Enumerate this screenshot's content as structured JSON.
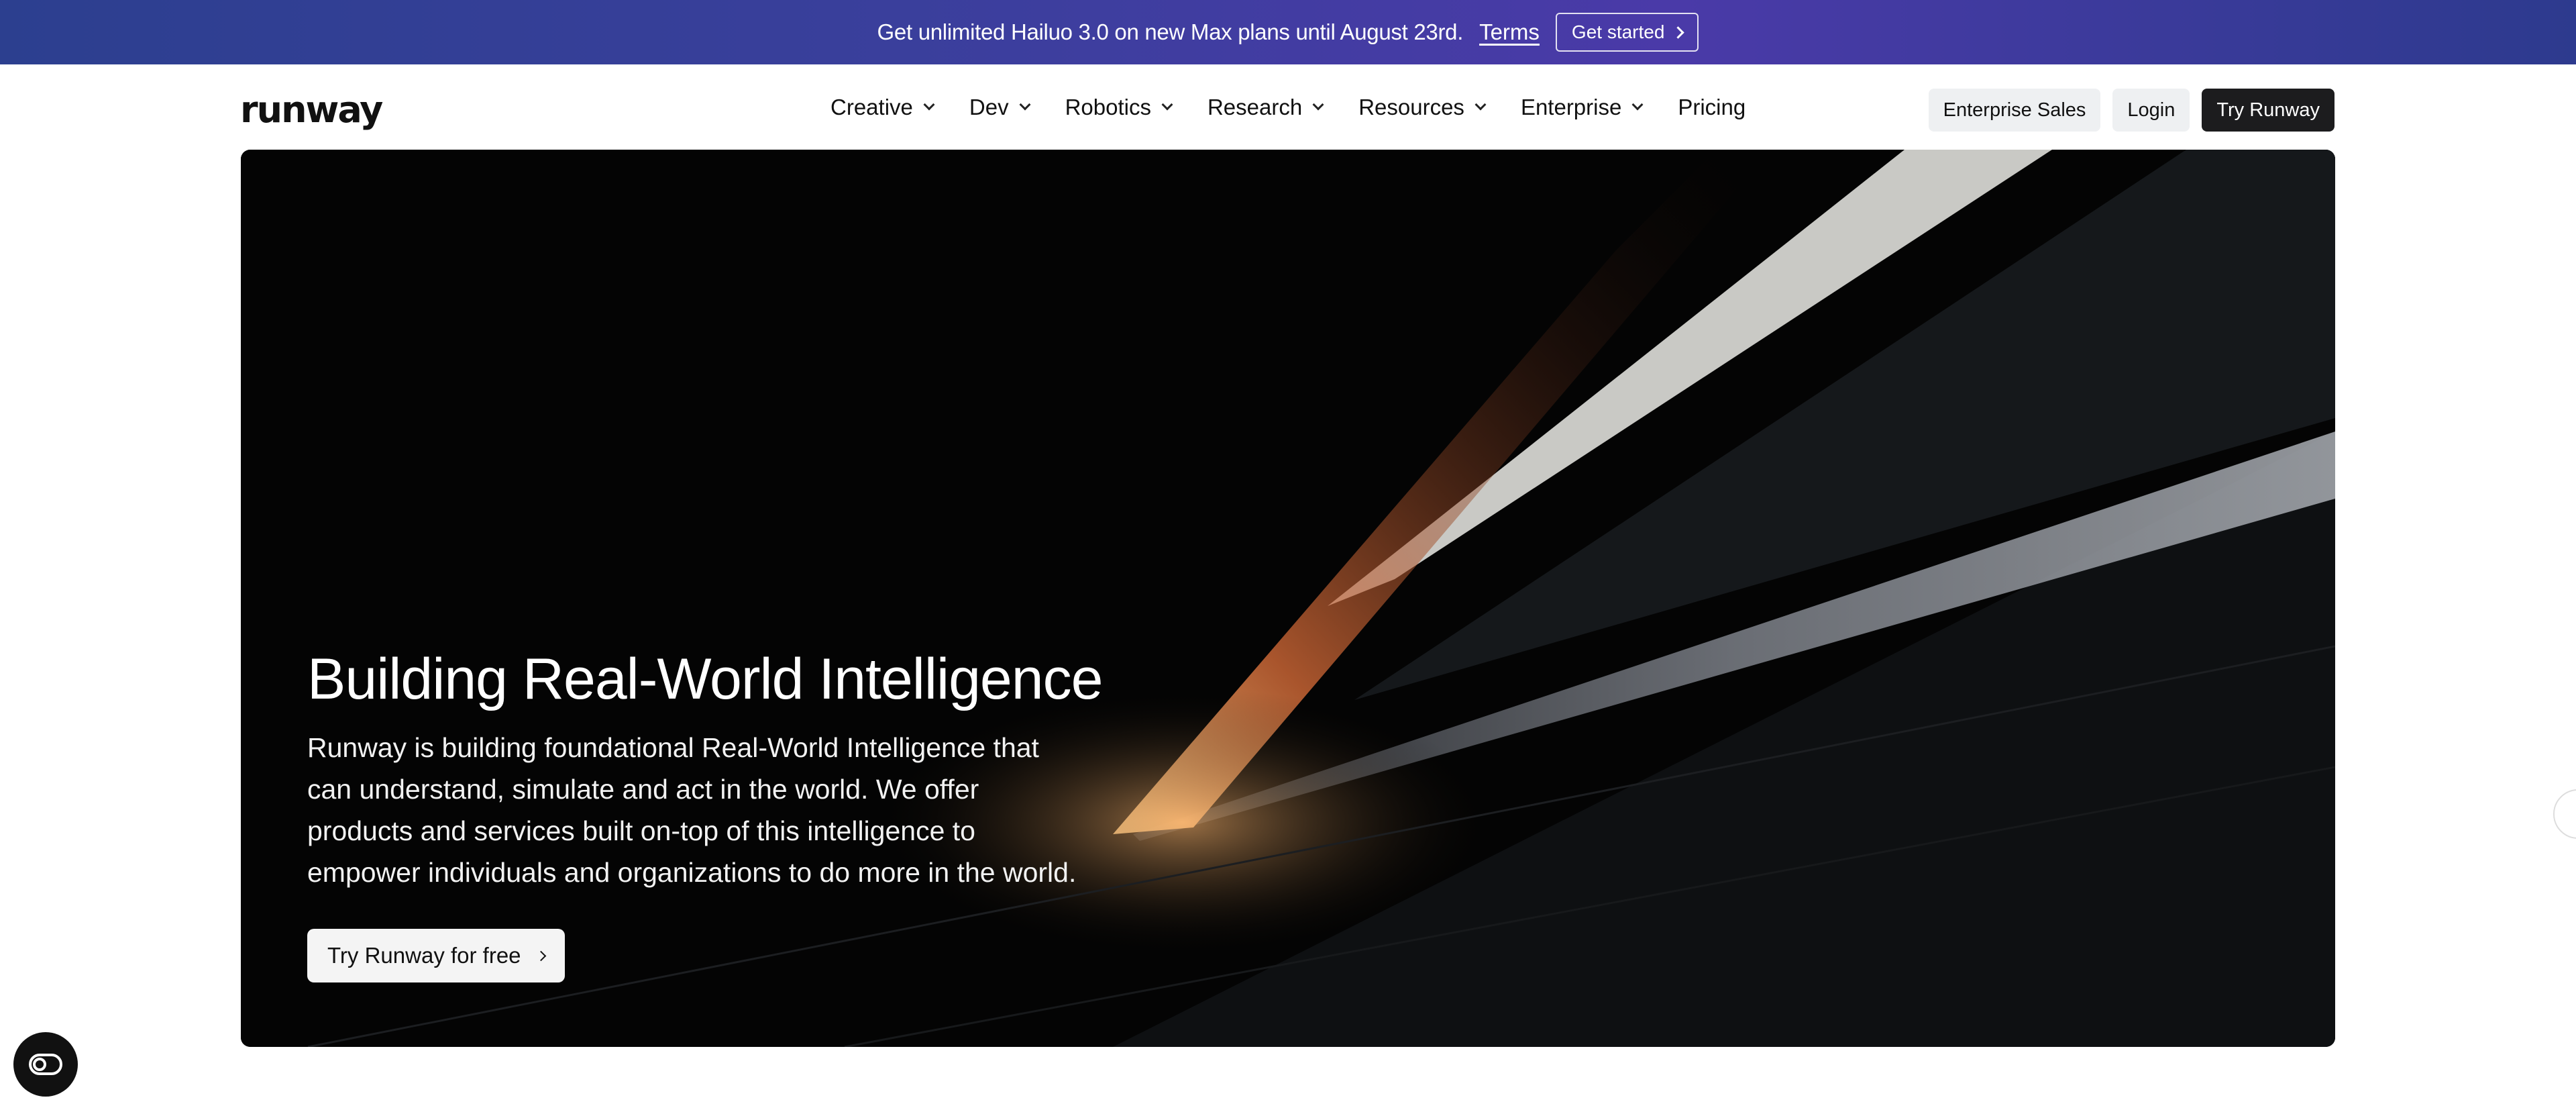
{
  "banner": {
    "message": "Get unlimited Hailuo 3.0 on new Max plans until August 23rd.",
    "terms_label": "Terms",
    "cta_label": "Get started"
  },
  "nav": {
    "logo": "runway",
    "items": [
      {
        "label": "Creative",
        "has_dropdown": true
      },
      {
        "label": "Dev",
        "has_dropdown": true
      },
      {
        "label": "Robotics",
        "has_dropdown": true
      },
      {
        "label": "Research",
        "has_dropdown": true
      },
      {
        "label": "Resources",
        "has_dropdown": true
      },
      {
        "label": "Enterprise",
        "has_dropdown": true
      },
      {
        "label": "Pricing",
        "has_dropdown": false
      }
    ],
    "enterprise_sales_label": "Enterprise Sales",
    "login_label": "Login",
    "try_label": "Try Runway"
  },
  "hero": {
    "title": "Building Real-World Intelligence",
    "description": "Runway is building foundational Real-World Intelligence that can understand, simulate and act in the world. We offer products and services built on-top of this intelligence to empower individuals and organizations to do more in the world.",
    "cta_label": "Try Runway for free"
  },
  "icons": {
    "fab": "cookie-settings-icon",
    "side": "feedback-icon"
  },
  "colors": {
    "banner_start": "#2c3f8f",
    "banner_end": "#4a3aa8",
    "dark_button": "#1c1c1e",
    "light_button": "#eef0f2"
  }
}
